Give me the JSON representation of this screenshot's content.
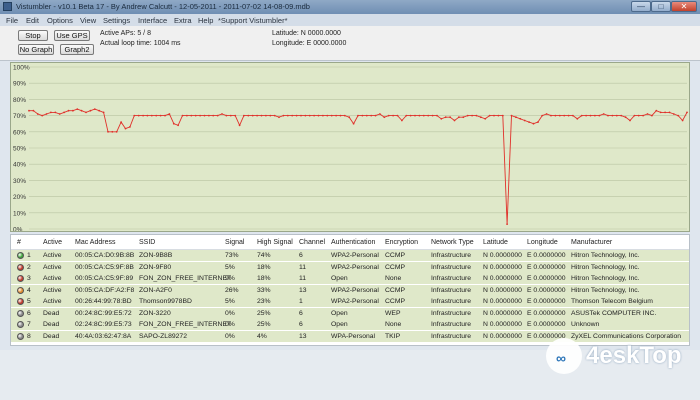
{
  "window": {
    "title": "Vistumbler - v10.1 Beta 17 - By Andrew Calcutt - 12-05-2011 - 2011-07-02 14-08-09.mdb",
    "controls": {
      "minimize": "—",
      "maximize": "□",
      "close": "✕"
    }
  },
  "menu": [
    "File",
    "Edit",
    "Options",
    "View",
    "Settings",
    "Interface",
    "Extra",
    "Help",
    "*Support Vistumbler*"
  ],
  "toolbar": {
    "stop": "Stop",
    "use_gps": "Use GPS",
    "no_graph": "No Graph",
    "graph2": "Graph2",
    "active_aps": "Active APs: 5 / 8",
    "loop_time": "Actual loop time: 1004 ms",
    "latitude": "Latitude: N 0000.0000",
    "longitude": "Longitude: E 0000.0000"
  },
  "chart_data": {
    "type": "line",
    "ylim": [
      0,
      100
    ],
    "yticks": [
      "100%",
      "90%",
      "80%",
      "70%",
      "60%",
      "50%",
      "40%",
      "30%",
      "20%",
      "10%",
      "0%"
    ],
    "grid": true,
    "line_color": "#e0302a",
    "values": [
      73,
      73,
      71,
      70,
      71,
      72,
      72,
      71,
      72,
      73,
      73,
      74,
      73,
      72,
      73,
      74,
      73,
      72,
      60,
      60,
      60,
      66,
      62,
      63,
      70,
      70,
      70,
      70,
      70,
      70,
      70,
      70,
      71,
      65,
      64,
      70,
      70,
      70,
      70,
      70,
      70,
      70,
      70,
      70,
      71,
      70,
      70,
      70,
      64,
      70,
      70,
      70,
      70,
      70,
      70,
      70,
      70,
      69,
      70,
      70,
      70,
      70,
      70,
      70,
      70,
      70,
      70,
      70,
      70,
      70,
      70,
      70,
      70,
      69,
      65,
      70,
      70,
      70,
      70,
      70,
      71,
      69,
      70,
      70,
      70,
      67,
      70,
      70,
      70,
      70,
      70,
      70,
      70,
      70,
      68,
      69,
      69,
      67,
      69,
      69,
      70,
      70,
      70,
      69,
      68,
      70,
      70,
      70,
      70,
      3,
      70,
      69,
      68,
      67,
      66,
      65,
      66,
      70,
      71,
      70,
      70,
      70,
      70,
      70,
      70,
      68,
      70,
      70,
      70,
      70,
      70,
      71,
      70,
      70,
      70,
      70,
      69,
      67,
      70,
      70,
      70,
      71,
      70,
      73,
      72,
      72,
      72,
      71,
      70,
      67,
      72
    ]
  },
  "table": {
    "headers": [
      "#",
      "Active",
      "Mac Address",
      "SSID",
      "Signal",
      "High Signal",
      "Channel",
      "Authentication",
      "Encryption",
      "Network Type",
      "Latitude",
      "Longitude",
      "Manufacturer"
    ],
    "rows": [
      {
        "num": "1",
        "active": "Active",
        "mac": "00:05:CA:D0:9B:8B",
        "ssid": "ZON-9B8B",
        "signal": "73%",
        "high": "74%",
        "channel": "6",
        "auth": "WPA2-Personal",
        "enc": "CCMP",
        "type": "Infrastructure",
        "lat": "N 0.0000000",
        "lon": "E 0.0000000",
        "mfr": "Hitron Technology, Inc.",
        "dot": "#3fa33a"
      },
      {
        "num": "2",
        "active": "Active",
        "mac": "00:05:CA:C5:9F:8B",
        "ssid": "ZON-9F80",
        "signal": "5%",
        "high": "18%",
        "channel": "11",
        "auth": "WPA2-Personal",
        "enc": "CCMP",
        "type": "Infrastructure",
        "lat": "N 0.0000000",
        "lon": "E 0.0000000",
        "mfr": "Hitron Technology, Inc.",
        "dot": "#c0392b"
      },
      {
        "num": "3",
        "active": "Active",
        "mac": "00:05:CA:C5:9F:89",
        "ssid": "FON_ZON_FREE_INTERNET",
        "signal": "9%",
        "high": "18%",
        "channel": "11",
        "auth": "Open",
        "enc": "None",
        "type": "Infrastructure",
        "lat": "N 0.0000000",
        "lon": "E 0.0000000",
        "mfr": "Hitron Technology, Inc.",
        "dot": "#c0392b"
      },
      {
        "num": "4",
        "active": "Active",
        "mac": "00:05:CA:DF:A2:F8",
        "ssid": "ZON-A2F0",
        "signal": "26%",
        "high": "33%",
        "channel": "13",
        "auth": "WPA2-Personal",
        "enc": "CCMP",
        "type": "Infrastructure",
        "lat": "N 0.0000000",
        "lon": "E 0.0000000",
        "mfr": "Hitron Technology, Inc.",
        "dot": "#e08a2a"
      },
      {
        "num": "5",
        "active": "Active",
        "mac": "00:26:44:99:78:BD",
        "ssid": "Thomson9978BD",
        "signal": "5%",
        "high": "23%",
        "channel": "1",
        "auth": "WPA2-Personal",
        "enc": "CCMP",
        "type": "Infrastructure",
        "lat": "N 0.0000000",
        "lon": "E 0.0000000",
        "mfr": "Thomson Telecom Belgium",
        "dot": "#c0392b"
      },
      {
        "num": "6",
        "active": "Dead",
        "mac": "00:24:8C:99:E5:72",
        "ssid": "ZON-3220",
        "signal": "0%",
        "high": "25%",
        "channel": "6",
        "auth": "Open",
        "enc": "WEP",
        "type": "Infrastructure",
        "lat": "N 0.0000000",
        "lon": "E 0.0000000",
        "mfr": "ASUSTek COMPUTER INC.",
        "dot": "#8a8a8a"
      },
      {
        "num": "7",
        "active": "Dead",
        "mac": "02:24:8C:99:E5:73",
        "ssid": "FON_ZON_FREE_INTERNET",
        "signal": "0%",
        "high": "25%",
        "channel": "6",
        "auth": "Open",
        "enc": "None",
        "type": "Infrastructure",
        "lat": "N 0.0000000",
        "lon": "E 0.0000000",
        "mfr": "Unknown",
        "dot": "#8a8a8a"
      },
      {
        "num": "8",
        "active": "Dead",
        "mac": "40:4A:03:62:47:8A",
        "ssid": "SAPO-ZL89272",
        "signal": "0%",
        "high": "4%",
        "channel": "13",
        "auth": "WPA-Personal",
        "enc": "TKIP",
        "type": "Infrastructure",
        "lat": "N 0.0000000",
        "lon": "E 0.0000000",
        "mfr": "ZyXEL Communications Corporation",
        "dot": "#8a8a8a"
      }
    ]
  },
  "watermark": {
    "text": "4eskTop",
    "icon": "cloud-icon",
    "icon_glyph": "∞"
  }
}
